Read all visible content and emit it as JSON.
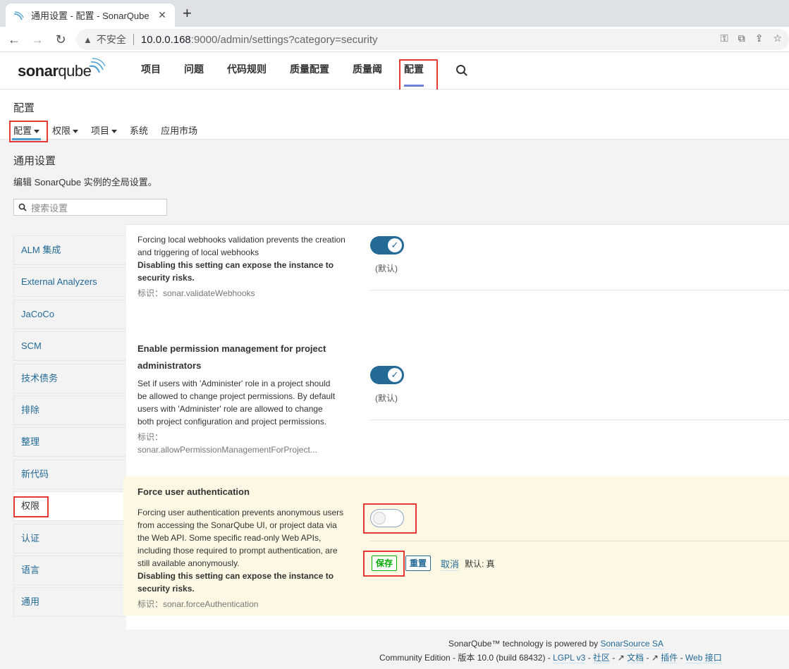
{
  "browser": {
    "tab_title": "通用设置 - 配置 - SonarQube",
    "insecure_label": "不安全",
    "url_host": "10.0.0.168",
    "url_rest": ":9000/admin/settings?category=security"
  },
  "header": {
    "logo_main": "sonar",
    "logo_q": "qube",
    "nav": [
      "项目",
      "问题",
      "代码规则",
      "质量配置",
      "质量阈",
      "配置"
    ]
  },
  "page": {
    "title": "配置",
    "subnav": [
      "配置",
      "权限",
      "项目",
      "系统",
      "应用市场"
    ],
    "section_title": "通用设置",
    "section_desc": "编辑 SonarQube 实例的全局设置。",
    "search_placeholder": "搜索设置"
  },
  "sidebar": [
    "ALM 集成",
    "External Analyzers",
    "JaCoCo",
    "SCM",
    "技术债务",
    "排除",
    "整理",
    "新代码",
    "权限",
    "认证",
    "语言",
    "通用"
  ],
  "settings": [
    {
      "name": "",
      "desc": "Forcing local webhooks validation prevents the creation and triggering of local webhooks",
      "warning": "Disabling this setting can expose the instance to security risks.",
      "key": "标识：sonar.validateWebhooks",
      "default_label": "(默认)",
      "enabled": true
    },
    {
      "name": "Enable permission management for project administrators",
      "desc": "Set if users with 'Administer' role in a project should be allowed to change project permissions. By default users with 'Administer' role are allowed to change both project configuration and project permissions.",
      "warning": "",
      "key": "标识：sonar.allowPermissionManagementForProject...",
      "default_label": "(默认)",
      "enabled": true
    },
    {
      "name": "Force user authentication",
      "desc": "Forcing user authentication prevents anonymous users from accessing the SonarQube UI, or project data via the Web API. Some specific read-only Web APIs, including those required to prompt authentication, are still available anonymously.",
      "warning": "Disabling this setting can expose the instance to security risks.",
      "key": "标识：sonar.forceAuthentication",
      "enabled": false,
      "save_label": "保存",
      "reset_label": "重置",
      "cancel_label": "取消",
      "default_value": "默认: 真"
    }
  ],
  "footer": {
    "line1_prefix": "SonarQube™ technology is powered by ",
    "line1_link": "SonarSource SA",
    "line2_prefix": "Community Edition - 版本 10.0 (build 68432) - ",
    "links": [
      "LGPL v3",
      "社区",
      "文档",
      "插件",
      "Web 接口"
    ]
  }
}
